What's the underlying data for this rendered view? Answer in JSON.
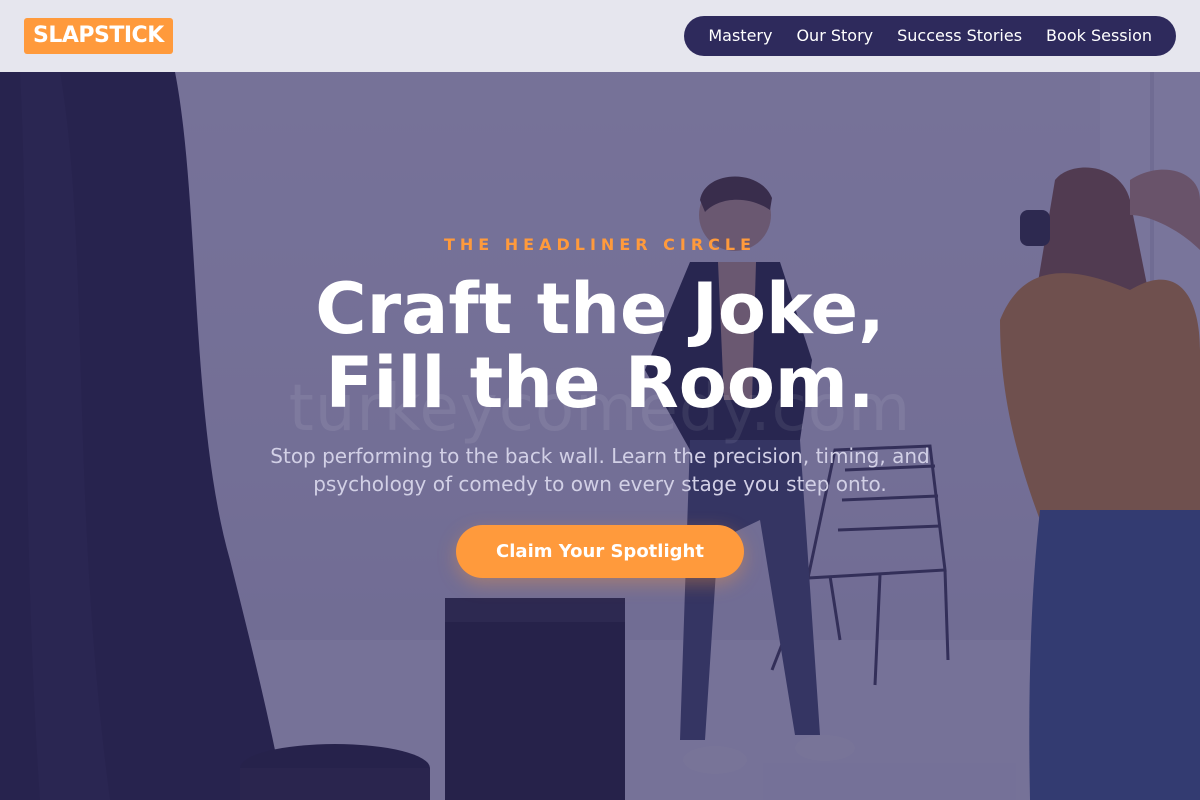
{
  "brand": {
    "logo": "SLAPSTICK",
    "accent_color": "#ff9a3c",
    "nav_color": "#2e2a5c"
  },
  "nav": {
    "items": [
      {
        "label": "Mastery"
      },
      {
        "label": "Our Story"
      },
      {
        "label": "Success Stories"
      },
      {
        "label": "Book Session"
      }
    ]
  },
  "hero": {
    "eyebrow": "THE HEADLINER CIRCLE",
    "headline_line1": "Craft the Joke,",
    "headline_line2": "Fill the Room.",
    "subtext": "Stop performing to the back wall. Learn the precision, timing, and psychology of comedy to own every stage you step onto.",
    "cta_label": "Claim Your Spotlight",
    "watermark": "turkeycomedy.com"
  }
}
